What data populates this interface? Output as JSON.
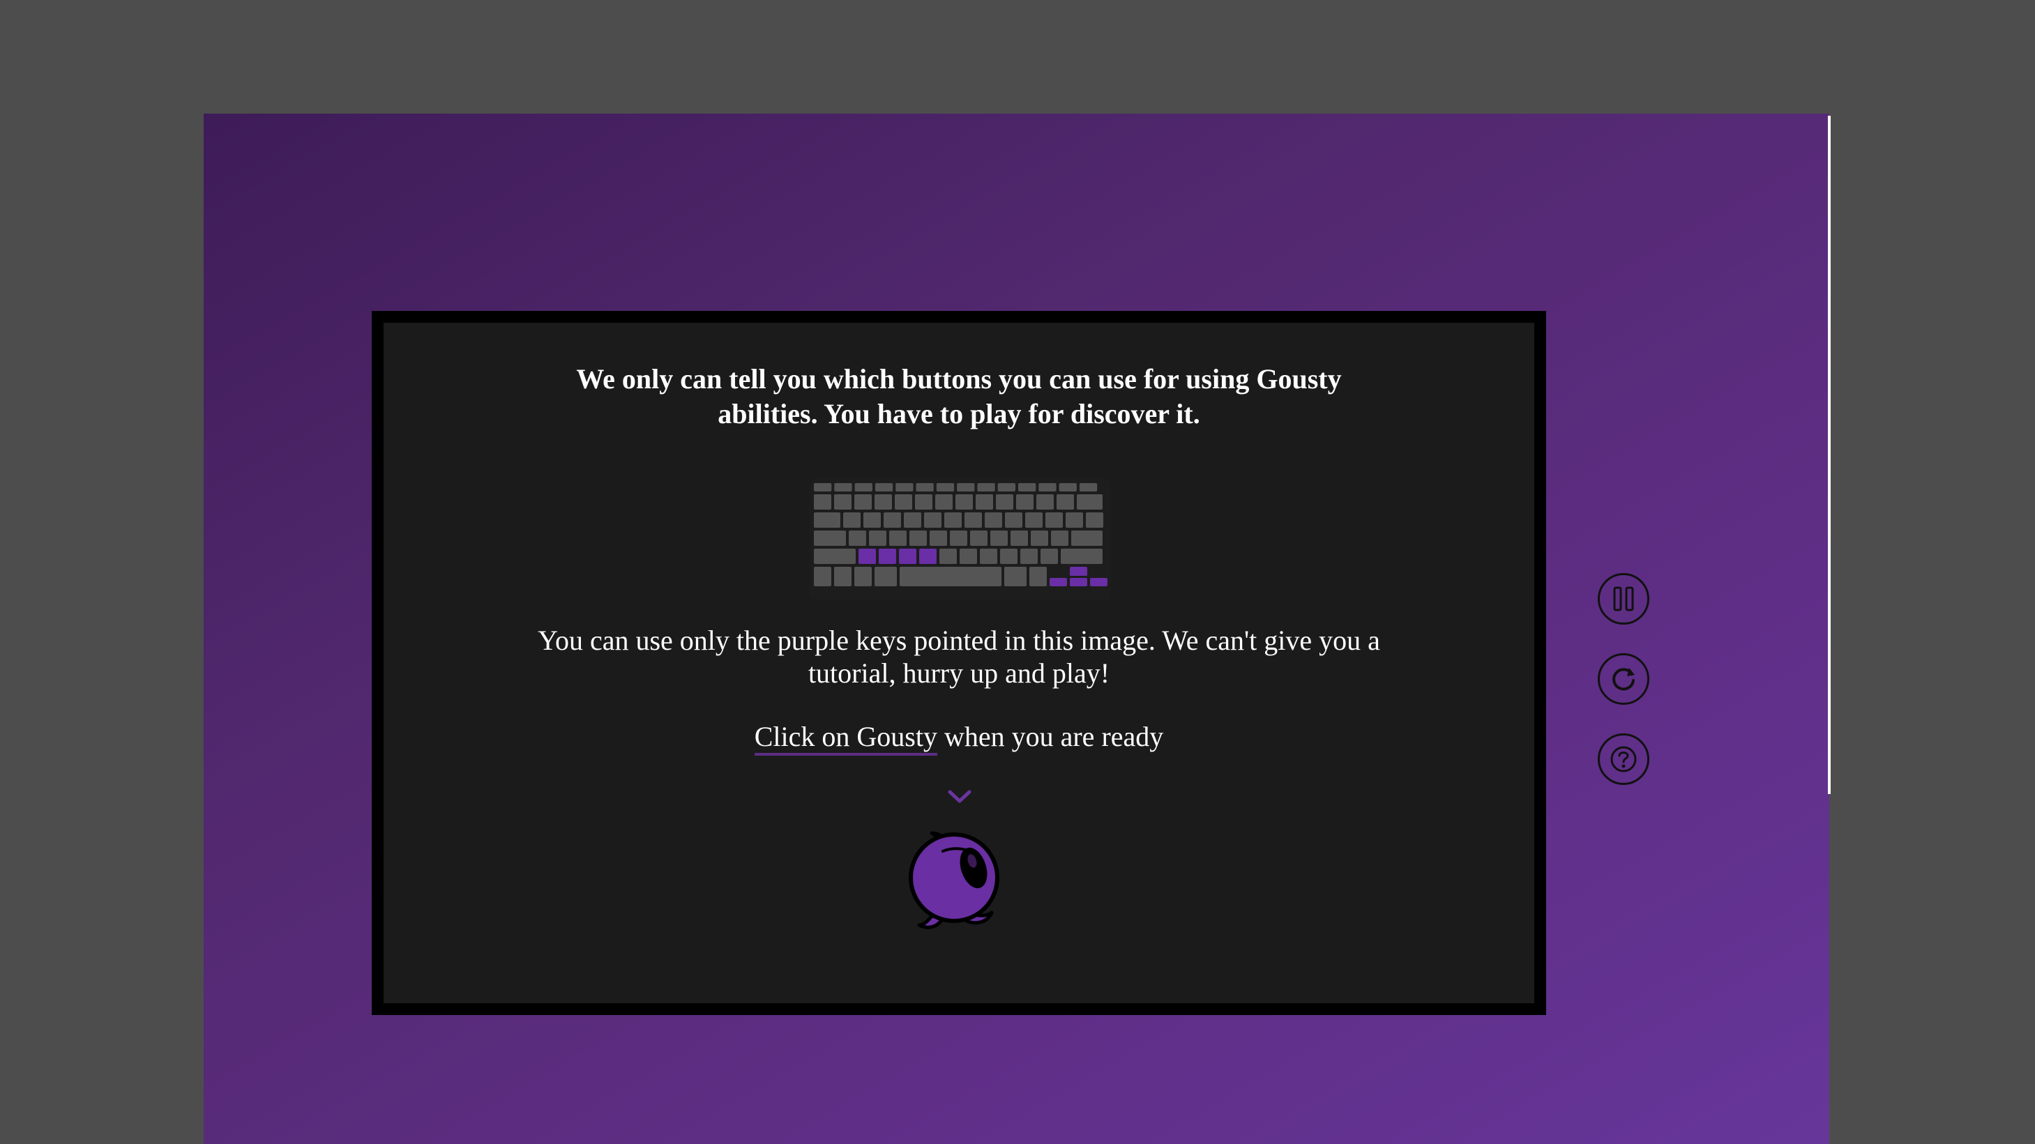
{
  "tutorial": {
    "heading": "We only can tell you which buttons you can use for using Gousty abilities. You have to play for discover it.",
    "info": "You can use only the purple keys pointed in this image. We can't give you a tutorial, hurry up and play!",
    "ready_link": "Click on Gousty",
    "ready_rest": " when you are ready"
  },
  "keyboard": {
    "highlighted_keys": [
      "Z",
      "X",
      "C",
      "V",
      "left-arrow",
      "up-arrow",
      "down-arrow",
      "right-arrow"
    ],
    "highlight_color": "#6a2ea6"
  },
  "controls": [
    {
      "name": "pause",
      "icon": "pause-icon"
    },
    {
      "name": "restart",
      "icon": "restart-icon"
    },
    {
      "name": "help",
      "icon": "help-icon"
    }
  ],
  "colors": {
    "background": "#4d4d4d",
    "frame_gradient_start": "#3e1c58",
    "frame_gradient_end": "#66369a",
    "panel": "#1b1b1b",
    "accent": "#6a35a0"
  }
}
